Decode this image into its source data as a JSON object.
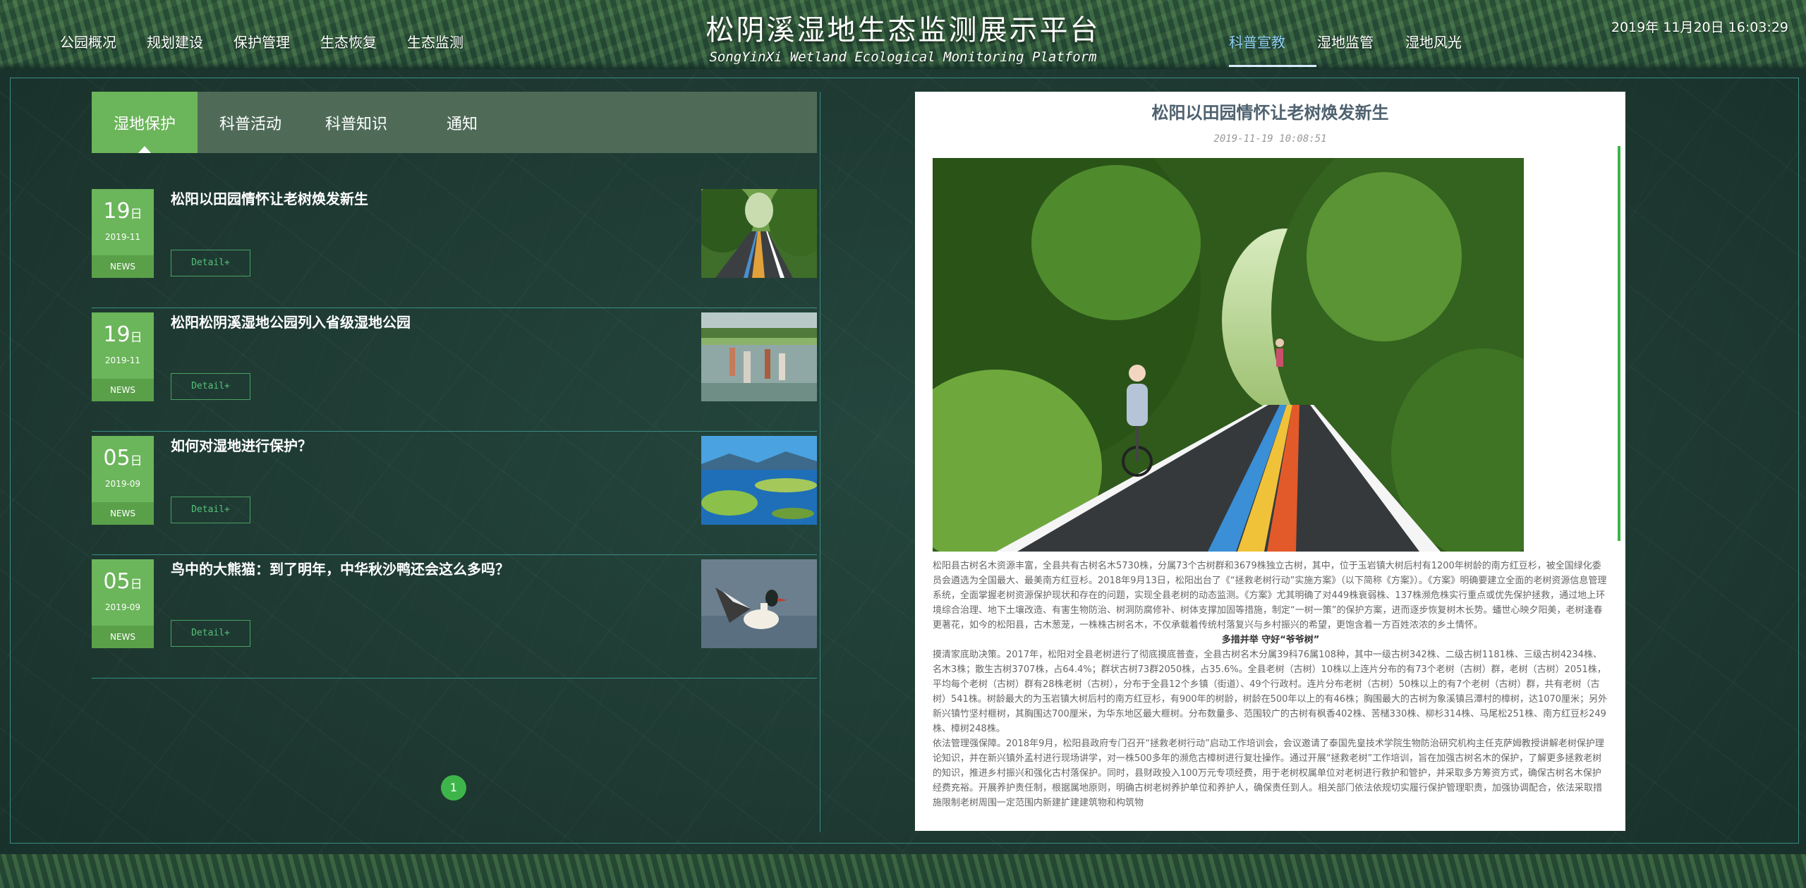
{
  "header": {
    "nav_left": [
      "公园概况",
      "规划建设",
      "保护管理",
      "生态恢复",
      "生态监测"
    ],
    "title_cn": "松阴溪湿地生态监测展示平台",
    "title_en": "SongYinXi Wetland Ecological Monitoring Platform",
    "nav_right": [
      "科普宣教",
      "湿地监管",
      "湿地风光"
    ],
    "active_nav": "科普宣教",
    "datetime": "2019年 11月20日 16:03:29"
  },
  "tabs": [
    "湿地保护",
    "科普活动",
    "科普知识",
    "通知"
  ],
  "active_tab": "湿地保护",
  "news": [
    {
      "day": "19",
      "day_unit": "日",
      "ym": "2019-11",
      "tag": "NEWS",
      "title": "松阳以田园情怀让老树焕发新生",
      "detail": "Detail+",
      "thumb": "forest-road-photo"
    },
    {
      "day": "19",
      "day_unit": "日",
      "ym": "2019-11",
      "tag": "NEWS",
      "title": "松阳松阴溪湿地公园列入省级湿地公园",
      "detail": "Detail+",
      "thumb": "wetland-reflection-photo"
    },
    {
      "day": "05",
      "day_unit": "日",
      "ym": "2019-09",
      "tag": "NEWS",
      "title": "如何对湿地进行保护？",
      "detail": "Detail+",
      "thumb": "wetland-lake-photo"
    },
    {
      "day": "05",
      "day_unit": "日",
      "ym": "2019-09",
      "tag": "NEWS",
      "title": "鸟中的大熊猫：到了明年，中华秋沙鸭还会这么多吗？",
      "detail": "Detail+",
      "thumb": "merganser-duck-photo"
    }
  ],
  "pagination": {
    "current": "1"
  },
  "article": {
    "title": "松阳以田园情怀让老树焕发新生",
    "date": "2019-11-19 10:08:51",
    "photo": "cyclist-forest-road-photo",
    "paragraphs": [
      "松阳县古树名木资源丰富，全县共有古树名木5730株，分属73个古树群和3679株独立古树，其中，位于玉岩镇大树后村有1200年树龄的南方红豆杉，被全国绿化委员会遴选为全国最大、最美南方红豆杉。2018年9月13日，松阳出台了《“拯救老树行动”实施方案》（以下简称《方案》）。《方案》明确要建立全面的老树资源信息管理系统，全面掌握老树资源保护现状和存在的问题，实现全县老树的动态监测。《方案》尤其明确了对449株衰弱株、137株濒危株实行重点或优先保护拯救，通过地上环境综合治理、地下土壤改造、有害生物防治、树洞防腐修补、树体支撑加固等措施，制定“一树一策”的保护方案，进而逐步恢复树木长势。蟠世心映夕阳美，老树逢春更著花，如今的松阳县，古木葱茏，一株株古树名木，不仅承载着传统村落复兴与乡村振兴的希望，更饱含着一方百姓浓浓的乡土情怀。"
    ],
    "subhead": "多措并举 守好“爷爷树”",
    "paragraphs2": [
      "摸清家底助决策。2017年，松阳对全县老树进行了彻底摸底普查，全县古树名木分属39科76属108种，其中一级古树342株、二级古树1181株、三级古树4234株、名木3株；散生古树3707株，占64.4%；群状古树73群2050株，占35.6%。全县老树（古树）10株以上连片分布的有73个老树（古树）群，老树（古树）2051株，平均每个老树（古树）群有28株老树（古树），分布于全县12个乡镇（街道）、49个行政村。连片分布老树（古树）50株以上的有7个老树（古树）群，共有老树（古树）541株。树龄最大的为玉岩镇大树后村的南方红豆杉，有900年的树龄，树龄在500年以上的有46株；胸围最大的古树为象溪镇吕潭村的樟树，达1070厘米；另外新兴镇竹坚村榧树，其胸围达700厘米，为华东地区最大榧树。分布数量多、范围较广的古树有枫香402株、苦槠330株、柳杉314株、马尾松251株、南方红豆杉249株、樟树248株。",
      "依法管理强保障。2018年9月，松阳县政府专门召开“拯救老树行动”启动工作培训会，会议邀请了泰国先皇技术学院生物防治研究机构主任克萨姆教授讲解老树保护理论知识，并在新兴镇外孟村进行现场讲学，对一株500多年的濒危古樟树进行复壮操作。通过开展“拯救老树”工作培训，旨在加强古树名木的保护，了解更多拯救老树的知识，推进乡村振兴和强化古村落保护。同时，县财政投入100万元专项经费，用于老树权属单位对老树进行救护和管护，并采取多方筹资方式，确保古树名木保护经费充裕。开展养护责任制，根据属地原则，明确古树老树养护单位和养护人，确保责任到人。相关部门依法依规切实履行保护管理职责，加强协调配合，依法采取措施限制老树周围一定范围内新建扩建建筑物和构筑物"
    ]
  },
  "colors": {
    "accent_green": "#6bb55a",
    "frame_line": "#3a8c86",
    "active_nav": "#8ed0f5",
    "page_button": "#3eb54a"
  }
}
